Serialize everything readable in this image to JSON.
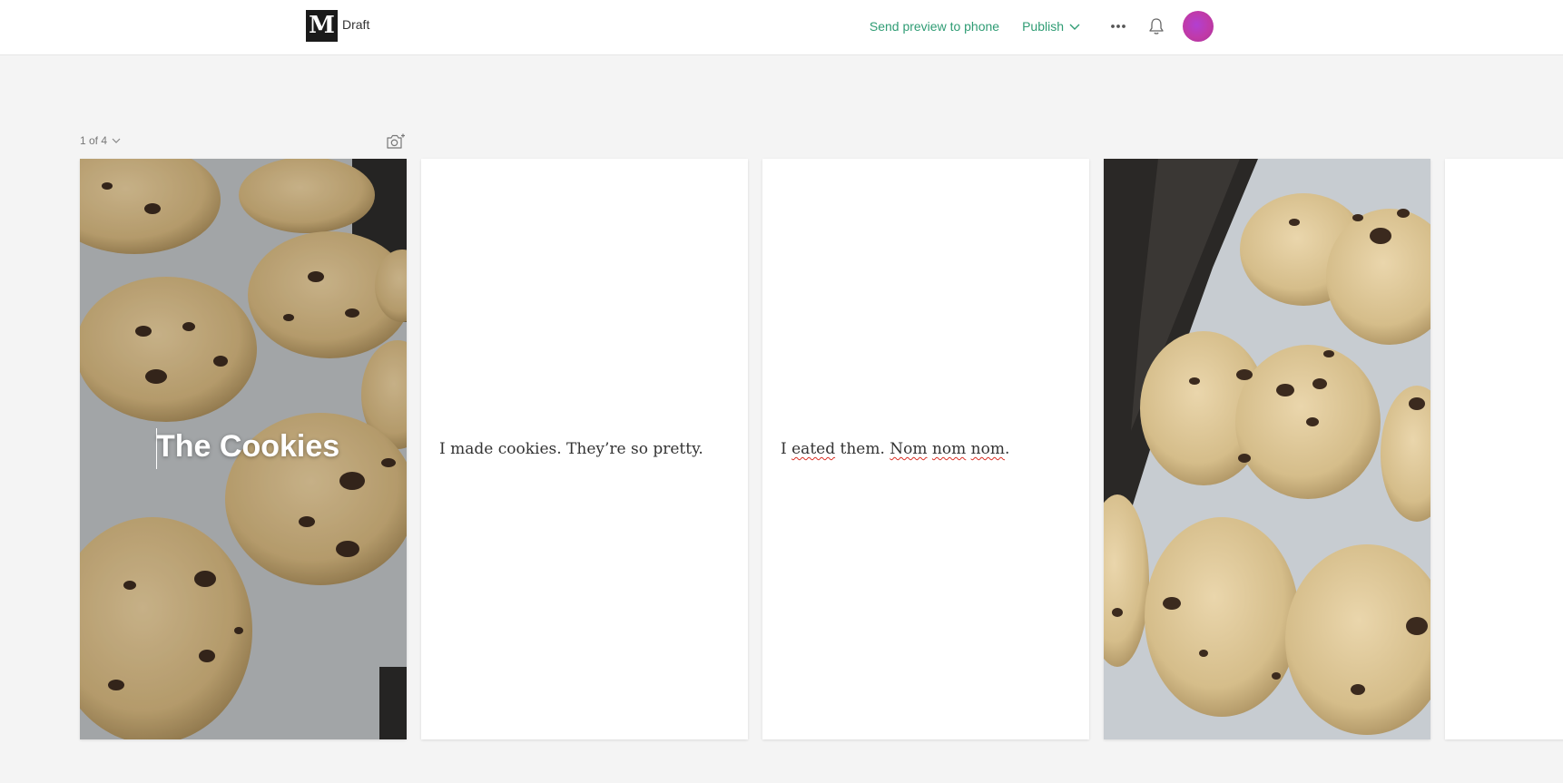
{
  "header": {
    "logo_letter": "M",
    "status": "Draft",
    "send_preview_label": "Send preview to phone",
    "publish_label": "Publish"
  },
  "colors": {
    "accent": "#2f9c74",
    "avatar": "#b23fd1",
    "background": "#f4f4f4"
  },
  "stories": {
    "counter_label": "1 of 4",
    "cards": [
      {
        "kind": "image",
        "image": "cookies-on-baking-tray-photo",
        "title": "The Cookies"
      },
      {
        "kind": "text",
        "segments": [
          "I made cookies. They’re so pretty."
        ]
      },
      {
        "kind": "text",
        "segments": [
          "I ",
          "eated",
          " them. ",
          "Nom",
          " ",
          "nom",
          " ",
          "nom",
          "."
        ]
      },
      {
        "kind": "image",
        "image": "cookies-on-baking-tray-photo"
      },
      {
        "kind": "blank"
      }
    ]
  }
}
